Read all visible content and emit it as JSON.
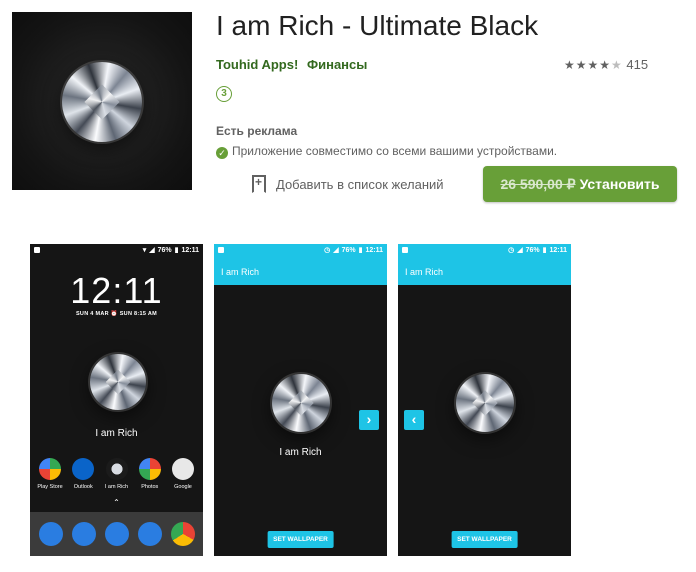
{
  "app": {
    "title": "I am Rich - Ultimate Black",
    "developer": "Touhid Apps!",
    "category": "Финансы",
    "rating_stars": 4,
    "rating_count": "415",
    "age_rating": "3",
    "ads_label": "Есть реклама",
    "compat_text": "Приложение совместимо со всеми вашими устройствами.",
    "wishlist_label": "Добавить в список желаний",
    "price_old": "26 590,00 ₽",
    "install_label": "Установить"
  },
  "colors": {
    "accent_green": "#689f38",
    "dev_green": "#33691e",
    "teal": "#1ec4e6"
  },
  "screenshots": {
    "s1": {
      "status_time": "12:11",
      "battery": "76%",
      "clock": "12:11",
      "date_line": "SUN 4 MAR   ⏰ SUN 8:15 AM",
      "label": "I am Rich",
      "dock": [
        {
          "label": "Play Store",
          "icon": "play-store-icon"
        },
        {
          "label": "Outlook",
          "icon": "outlook-icon"
        },
        {
          "label": "I am Rich",
          "icon": "i-am-rich-icon"
        },
        {
          "label": "Photos",
          "icon": "photos-icon"
        },
        {
          "label": "Google",
          "icon": "google-icon"
        }
      ],
      "caret": "⌃",
      "nav": [
        "phone-icon",
        "messages-icon",
        "contacts-icon",
        "camera-icon",
        "chrome-icon"
      ]
    },
    "s2": {
      "status_time": "12:11",
      "battery": "76%",
      "appbar_title": "I am Rich",
      "label": "I am Rich",
      "next_arrow": "›",
      "button": "SET WALLPAPER"
    },
    "s3": {
      "status_time": "12:11",
      "battery": "76%",
      "appbar_title": "I am Rich",
      "prev_arrow": "‹",
      "button": "SET WALLPAPER"
    }
  }
}
